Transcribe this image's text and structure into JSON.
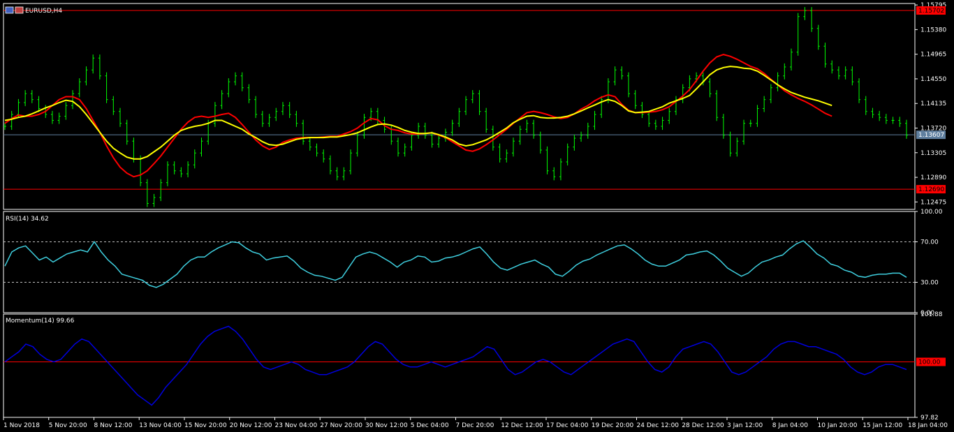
{
  "chart_data": [
    {
      "type": "line",
      "title": "EURUSD,H4",
      "ylim": [
        1.1235,
        1.1582
      ],
      "yticks": [
        1.15795,
        1.1538,
        1.14965,
        1.1455,
        1.14135,
        1.1372,
        1.13305,
        1.1289,
        1.12475
      ],
      "ytick_labels": [
        "1.15795",
        "1.15380",
        "1.14965",
        "1.14550",
        "1.14135",
        "1.13720",
        "1.13305",
        "1.12890",
        "1.12475"
      ],
      "hlines": [
        {
          "value": 1.15702,
          "label": "1.15702",
          "color": "#ff0000"
        },
        {
          "value": 1.1269,
          "label": "1.12690",
          "color": "#ff0000"
        },
        {
          "value": 1.13607,
          "label": "1.13607",
          "color": "#5f7f9f"
        }
      ],
      "series": [
        {
          "color": "#00ff00",
          "values": [
            1.1375,
            1.1395,
            1.1415,
            1.143,
            1.142,
            1.1405,
            1.1395,
            1.1385,
            1.1392,
            1.141,
            1.143,
            1.145,
            1.147,
            1.149,
            1.146,
            1.142,
            1.14,
            1.138,
            1.135,
            1.132,
            1.128,
            1.1245,
            1.1255,
            1.128,
            1.131,
            1.13,
            1.1295,
            1.131,
            1.133,
            1.135,
            1.138,
            1.141,
            1.143,
            1.145,
            1.146,
            1.144,
            1.142,
            1.1395,
            1.138,
            1.139,
            1.14,
            1.141,
            1.1395,
            1.138,
            1.135,
            1.134,
            1.133,
            1.132,
            1.13,
            1.129,
            1.13,
            1.133,
            1.136,
            1.139,
            1.14,
            1.1385,
            1.137,
            1.135,
            1.133,
            1.134,
            1.136,
            1.1375,
            1.136,
            1.1345,
            1.1355,
            1.1365,
            1.138,
            1.14,
            1.142,
            1.143,
            1.14,
            1.137,
            1.134,
            1.132,
            1.133,
            1.135,
            1.137,
            1.138,
            1.136,
            1.1335,
            1.13,
            1.129,
            1.1315,
            1.134,
            1.1355,
            1.136,
            1.1375,
            1.1395,
            1.142,
            1.145,
            1.147,
            1.146,
            1.143,
            1.141,
            1.1395,
            1.138,
            1.1375,
            1.1385,
            1.14,
            1.142,
            1.144,
            1.1455,
            1.146,
            1.145,
            1.143,
            1.139,
            1.136,
            1.133,
            1.135,
            1.138,
            1.138,
            1.1405,
            1.142,
            1.144,
            1.146,
            1.1475,
            1.15,
            1.156,
            1.157,
            1.154,
            1.151,
            1.148,
            1.147,
            1.146,
            1.147,
            1.145,
            1.142,
            1.14,
            1.1395,
            1.139,
            1.1385,
            1.1385,
            1.138,
            1.136
          ]
        },
        {
          "color": "#ff0000",
          "values": [
            1.138,
            1.1388,
            1.1394,
            1.1392,
            1.1392,
            1.1395,
            1.14,
            1.141,
            1.142,
            1.1425,
            1.1425,
            1.142,
            1.1405,
            1.1385,
            1.1365,
            1.1342,
            1.1322,
            1.1306,
            1.1296,
            1.129,
            1.1293,
            1.13,
            1.1312,
            1.1325,
            1.134,
            1.1355,
            1.137,
            1.1382,
            1.139,
            1.1392,
            1.139,
            1.1392,
            1.1395,
            1.1397,
            1.139,
            1.1378,
            1.1365,
            1.1352,
            1.1342,
            1.1336,
            1.134,
            1.1348,
            1.1352,
            1.1355,
            1.1356,
            1.1356,
            1.1356,
            1.1357,
            1.1358,
            1.1358,
            1.1362,
            1.1366,
            1.1372,
            1.1381,
            1.1388,
            1.1386,
            1.1376,
            1.137,
            1.1368,
            1.1364,
            1.1362,
            1.1362,
            1.1363,
            1.1364,
            1.136,
            1.1356,
            1.1349,
            1.1342,
            1.1335,
            1.1333,
            1.1337,
            1.1344,
            1.1352,
            1.1361,
            1.137,
            1.138,
            1.1389,
            1.1398,
            1.14,
            1.1398,
            1.1395,
            1.1391,
            1.1388,
            1.139,
            1.1396,
            1.1404,
            1.141,
            1.1418,
            1.1424,
            1.1428,
            1.1425,
            1.1412,
            1.1402,
            1.1398,
            1.1398,
            1.1399,
            1.14,
            1.1403,
            1.1408,
            1.1417,
            1.1426,
            1.1437,
            1.1452,
            1.1468,
            1.1482,
            1.1492,
            1.1496,
            1.1493,
            1.1488,
            1.1482,
            1.1476,
            1.1472,
            1.1464,
            1.1454,
            1.1445,
            1.1435,
            1.1428,
            1.1422,
            1.1417,
            1.1411,
            1.1404,
            1.1397,
            1.1392
          ]
        },
        {
          "color": "#ffff00",
          "values": [
            1.1385,
            1.1387,
            1.139,
            1.1392,
            1.1396,
            1.1401,
            1.1406,
            1.141,
            1.1415,
            1.1419,
            1.1417,
            1.1408,
            1.1395,
            1.138,
            1.1365,
            1.135,
            1.1338,
            1.133,
            1.1323,
            1.132,
            1.132,
            1.1324,
            1.1332,
            1.134,
            1.135,
            1.136,
            1.1368,
            1.1372,
            1.1375,
            1.1377,
            1.138,
            1.1385,
            1.1385,
            1.138,
            1.1375,
            1.137,
            1.1362,
            1.1356,
            1.1349,
            1.1344,
            1.1343,
            1.1345,
            1.1349,
            1.1353,
            1.1355,
            1.1356,
            1.1356,
            1.1356,
            1.1357,
            1.1357,
            1.1359,
            1.1361,
            1.1364,
            1.1369,
            1.1374,
            1.1378,
            1.1379,
            1.1377,
            1.1373,
            1.1368,
            1.1365,
            1.1363,
            1.1363,
            1.1364,
            1.1361,
            1.1357,
            1.1352,
            1.1345,
            1.1342,
            1.1344,
            1.1348,
            1.1352,
            1.1358,
            1.1365,
            1.1372,
            1.1381,
            1.1387,
            1.1392,
            1.1393,
            1.139,
            1.1389,
            1.1389,
            1.139,
            1.1392,
            1.1396,
            1.1401,
            1.1406,
            1.1411,
            1.1416,
            1.142,
            1.1417,
            1.141,
            1.1401,
            1.1398,
            1.1399,
            1.14,
            1.1404,
            1.1408,
            1.1414,
            1.1418,
            1.1422,
            1.1427,
            1.1438,
            1.145,
            1.1462,
            1.147,
            1.1474,
            1.1476,
            1.1475,
            1.1473,
            1.1472,
            1.1468,
            1.1461,
            1.1453,
            1.1445,
            1.1438,
            1.1432,
            1.1428,
            1.1424,
            1.1421,
            1.1418,
            1.1414,
            1.141
          ]
        }
      ]
    },
    {
      "type": "line",
      "title": "RSI(14) 34.62",
      "ylim": [
        0,
        100
      ],
      "yticks": [
        100,
        70,
        30,
        0
      ],
      "ytick_labels": [
        "100.00",
        "70.00",
        "30.00",
        "0.00"
      ],
      "hlines": [
        {
          "value": 70,
          "style": "dashed"
        },
        {
          "value": 30,
          "style": "dashed"
        }
      ],
      "series": [
        {
          "color": "#3fd0e0",
          "values": [
            46,
            60,
            64,
            66,
            59,
            52,
            55,
            50,
            54,
            58,
            60,
            62,
            60,
            70,
            60,
            52,
            46,
            38,
            36,
            34,
            32,
            27,
            25,
            28,
            33,
            38,
            46,
            52,
            55,
            55,
            60,
            64,
            67,
            70,
            69,
            64,
            60,
            58,
            52,
            54,
            55,
            56,
            51,
            44,
            40,
            37,
            36,
            34,
            32,
            35,
            45,
            55,
            58,
            60,
            58,
            54,
            50,
            45,
            50,
            52,
            56,
            55,
            50,
            51,
            54,
            55,
            57,
            60,
            63,
            65,
            58,
            50,
            44,
            42,
            45,
            48,
            50,
            52,
            48,
            45,
            38,
            36,
            41,
            47,
            51,
            53,
            57,
            60,
            63,
            66,
            67,
            63,
            58,
            52,
            48,
            46,
            46,
            49,
            52,
            57,
            58,
            60,
            61,
            57,
            51,
            44,
            40,
            36,
            39,
            45,
            50,
            52,
            55,
            57,
            63,
            68,
            71,
            65,
            58,
            54,
            48,
            46,
            42,
            40,
            36,
            35,
            37,
            38,
            38,
            39,
            39,
            35
          ]
        }
      ]
    },
    {
      "type": "line",
      "title": "Momentum(14) 99.66",
      "ylim": [
        97.82,
        101.88
      ],
      "yticks": [
        101.88,
        97.82
      ],
      "ytick_labels": [
        "101.88",
        "97.82"
      ],
      "hlines": [
        {
          "value": 100.0,
          "label": "100.00",
          "color": "#ff0000"
        }
      ],
      "series": [
        {
          "color": "#0000e0",
          "values": [
            100.0,
            100.2,
            100.4,
            100.7,
            100.6,
            100.3,
            100.1,
            100.0,
            100.1,
            100.4,
            100.7,
            100.9,
            100.8,
            100.5,
            100.2,
            99.9,
            99.6,
            99.3,
            99.0,
            98.7,
            98.5,
            98.3,
            98.6,
            99.0,
            99.3,
            99.6,
            99.9,
            100.3,
            100.7,
            101.0,
            101.2,
            101.3,
            101.4,
            101.2,
            100.9,
            100.5,
            100.1,
            99.8,
            99.7,
            99.8,
            99.9,
            100.0,
            99.9,
            99.7,
            99.6,
            99.5,
            99.5,
            99.6,
            99.7,
            99.8,
            100.0,
            100.3,
            100.6,
            100.8,
            100.7,
            100.4,
            100.1,
            99.9,
            99.8,
            99.8,
            99.9,
            100.0,
            99.9,
            99.8,
            99.9,
            100.0,
            100.1,
            100.2,
            100.4,
            100.6,
            100.5,
            100.1,
            99.7,
            99.5,
            99.6,
            99.8,
            100.0,
            100.1,
            100.0,
            99.8,
            99.6,
            99.5,
            99.7,
            99.9,
            100.1,
            100.3,
            100.5,
            100.7,
            100.8,
            100.9,
            100.8,
            100.4,
            100.0,
            99.7,
            99.6,
            99.8,
            100.2,
            100.5,
            100.6,
            100.7,
            100.8,
            100.7,
            100.4,
            100.0,
            99.6,
            99.5,
            99.6,
            99.8,
            100.0,
            100.2,
            100.5,
            100.7,
            100.8,
            100.8,
            100.7,
            100.6,
            100.6,
            100.5,
            100.4,
            100.3,
            100.1,
            99.8,
            99.6,
            99.5,
            99.6,
            99.8,
            99.9,
            99.9,
            99.8,
            99.7
          ]
        }
      ]
    }
  ],
  "x_axis_labels": [
    "1 Nov 2018",
    "5 Nov 20:00",
    "8 Nov 12:00",
    "13 Nov 04:00",
    "15 Nov 20:00",
    "20 Nov 12:00",
    "23 Nov 04:00",
    "27 Nov 20:00",
    "30 Nov 12:00",
    "5 Dec 04:00",
    "7 Dec 20:00",
    "12 Dec 12:00",
    "17 Dec 04:00",
    "19 Dec 20:00",
    "24 Dec 12:00",
    "28 Dec 12:00",
    "3 Jan 12:00",
    "8 Jan 04:00",
    "10 Jan 20:00",
    "15 Jan 12:00",
    "18 Jan 04:00"
  ],
  "colors": {
    "background": "#000000",
    "frame": "#ffffff",
    "grid_dash": "#c0c0c0"
  }
}
